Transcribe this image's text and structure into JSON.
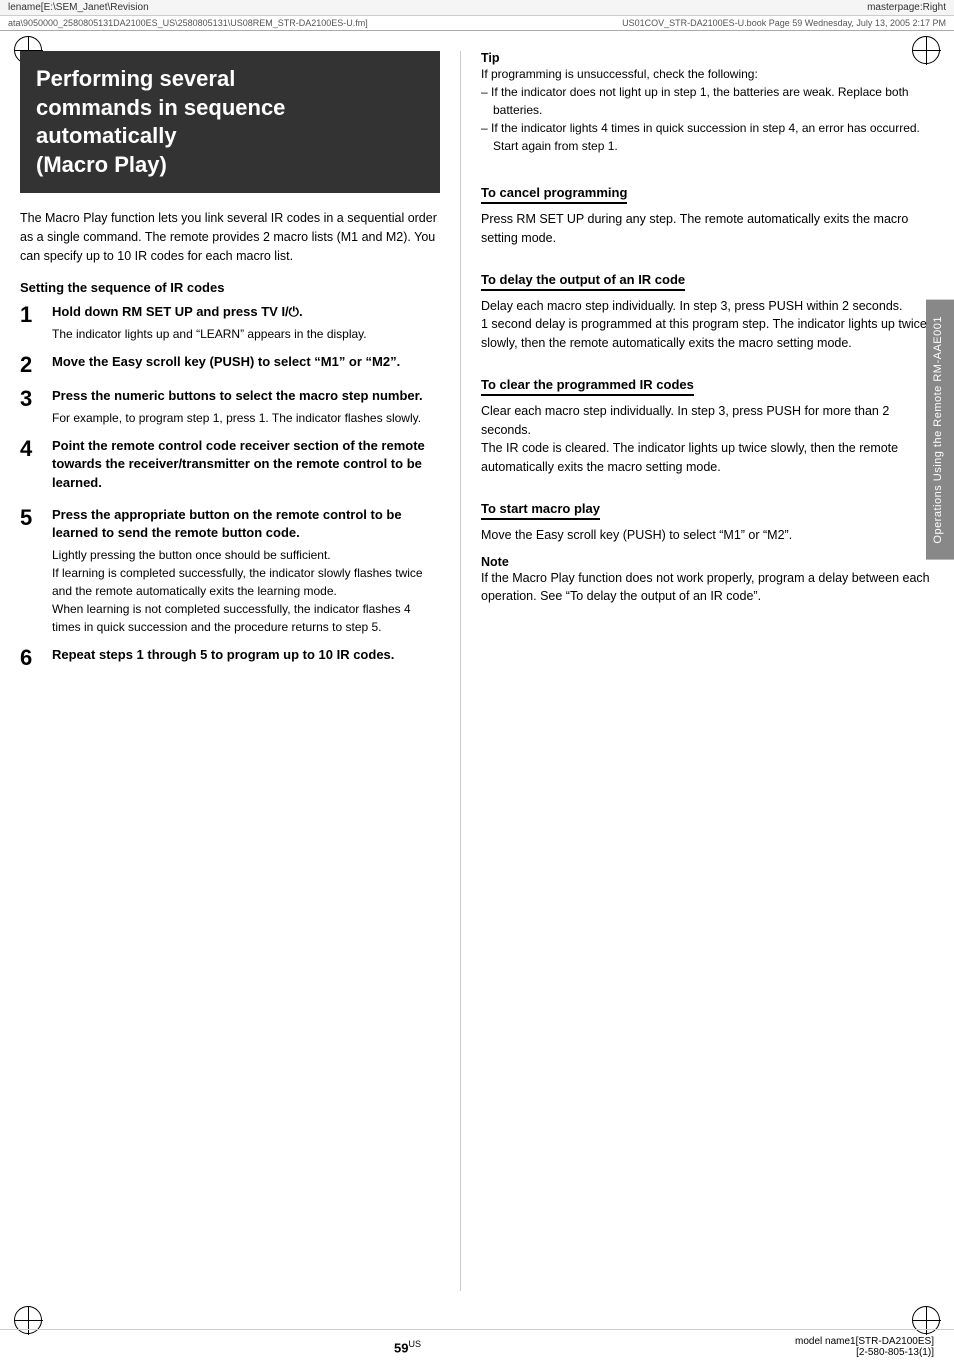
{
  "header": {
    "left_text": "lename[E:\\SEM_Janet\\Revision",
    "right_text": "masterpage:Right",
    "file_path": "ata\\9050000_2580805131DA2100ES_US\\2580805131\\US08REM_STR-DA2100ES-U.fm]",
    "file_info": "US01COV_STR-DA2100ES-U.book  Page 59  Wednesday, July 13, 2005  2:17 PM"
  },
  "title": {
    "line1": "Performing several",
    "line2": "commands in sequence",
    "line3": "automatically",
    "line4": "(Macro Play)"
  },
  "intro_text": "The Macro Play function lets you link several IR codes in a sequential order as a single command. The remote provides 2 macro lists (M1 and M2). You can specify up to 10 IR codes for each macro list.",
  "left_sections": [
    {
      "heading": "Setting the sequence of IR codes",
      "steps": [
        {
          "number": "1",
          "title": "Hold down RM SET UP and press TV I/⏻.",
          "body": "The indicator lights up and “LEARN” appears in the display."
        },
        {
          "number": "2",
          "title": "Move the Easy scroll key (PUSH) to select “M1” or “M2”.",
          "body": ""
        },
        {
          "number": "3",
          "title": "Press the numeric buttons to select the macro step number.",
          "body": "For example, to program step 1, press 1. The indicator flashes slowly."
        },
        {
          "number": "4",
          "title": "Point the remote control code receiver section of the remote towards the receiver/transmitter on the remote control to be learned.",
          "body": ""
        },
        {
          "number": "5",
          "title": "Press the appropriate button on the remote control to be learned to send the remote button code.",
          "body": "Lightly pressing the button once should be sufficient.\nIf learning is completed successfully, the indicator slowly flashes twice and the remote automatically exits the learning mode.\nWhen learning is not completed successfully, the indicator flashes 4 times in quick succession and the procedure returns to step 5."
        },
        {
          "number": "6",
          "title": "Repeat steps 1 through 5 to program up to 10 IR codes.",
          "body": ""
        }
      ]
    }
  ],
  "right_sections": {
    "tip": {
      "label": "Tip",
      "intro": "If programming is unsuccessful, check the following:",
      "items": [
        "If the indicator does not light up in step 1, the batteries are weak. Replace both batteries.",
        "If the indicator lights 4 times in quick succession in step 4, an error has occurred. Start again from step 1."
      ]
    },
    "cancel_programming": {
      "heading": "To cancel programming",
      "body": "Press RM SET UP during any step. The remote automatically exits the macro setting mode."
    },
    "delay_output": {
      "heading": "To delay the output of an IR code",
      "body": "Delay each macro step individually. In step 3, press PUSH within 2 seconds.\n1 second delay is programmed at this program step. The indicator lights up twice slowly, then the remote automatically exits the macro setting mode."
    },
    "clear_ir_codes": {
      "heading": "To clear the programmed IR codes",
      "body": "Clear each macro step individually. In step 3, press PUSH for more than 2 seconds.\nThe IR code is cleared. The indicator lights up twice slowly, then the remote automatically exits the macro setting mode."
    },
    "start_macro": {
      "heading": "To start macro play",
      "body": "Move the Easy scroll key (PUSH) to select “M1” or “M2”."
    },
    "note": {
      "label": "Note",
      "body": "If the Macro Play function does not work properly, program a delay between each operation. See “To delay the output of an IR code”."
    }
  },
  "side_tab": {
    "text": "Operations Using the Remote RM-AAE001"
  },
  "footer": {
    "page_number": "59",
    "superscript": "US",
    "model": "model name1[STR-DA2100ES]",
    "model_number": "[2-580-805-13(1)]"
  }
}
